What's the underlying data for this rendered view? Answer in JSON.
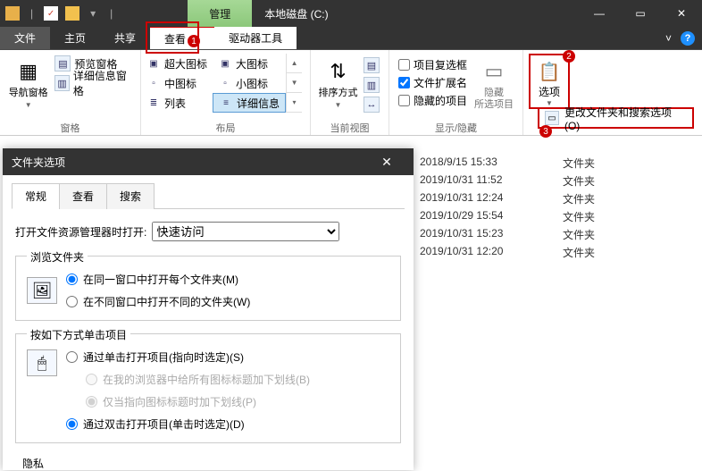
{
  "titlebar": {
    "contextual_tab": "管理",
    "window_title": "本地磁盘 (C:)"
  },
  "ribbon_tabs": {
    "file": "文件",
    "home": "主页",
    "share": "共享",
    "view": "查看",
    "drive_tools": "驱动器工具"
  },
  "annotations": {
    "one": "1",
    "two": "2",
    "three": "3"
  },
  "panes_group": {
    "nav_pane": "导航窗格",
    "preview_pane": "预览窗格",
    "details_pane": "详细信息窗格",
    "label": "窗格"
  },
  "layout_group": {
    "xl_icon": "超大图标",
    "l_icon": "大图标",
    "m_icon": "中图标",
    "s_icon": "小图标",
    "list": "列表",
    "details": "详细信息",
    "label": "布局"
  },
  "view_group": {
    "sort": "排序方式",
    "label": "当前视图"
  },
  "showhide_group": {
    "item_checkboxes": "项目复选框",
    "file_ext": "文件扩展名",
    "hidden_items": "隐藏的项目",
    "hide_selected": "隐藏\n所选项目",
    "label": "显示/隐藏"
  },
  "options_group": {
    "options": "选项",
    "change_folder_search": "更改文件夹和搜索选项(O)"
  },
  "files": [
    {
      "date": "2018/9/15 15:33",
      "type": "文件夹"
    },
    {
      "date": "2019/10/31 11:52",
      "type": "文件夹"
    },
    {
      "date": "2019/10/31 12:24",
      "type": "文件夹"
    },
    {
      "date": "2019/10/29 15:54",
      "type": "文件夹"
    },
    {
      "date": "2019/10/31 15:23",
      "type": "文件夹"
    },
    {
      "date": "2019/10/31 12:20",
      "type": "文件夹"
    }
  ],
  "dialog": {
    "title": "文件夹选项",
    "tabs": {
      "general": "常规",
      "view": "查看",
      "search": "搜索"
    },
    "open_label": "打开文件资源管理器时打开:",
    "open_value": "快速访问",
    "browse_legend": "浏览文件夹",
    "browse_opt1": "在同一窗口中打开每个文件夹(M)",
    "browse_opt2": "在不同窗口中打开不同的文件夹(W)",
    "click_legend": "按如下方式单击项目",
    "click_opt1": "通过单击打开项目(指向时选定)(S)",
    "click_sub1": "在我的浏览器中给所有图标标题加下划线(B)",
    "click_sub2": "仅当指向图标标题时加下划线(P)",
    "click_opt2": "通过双击打开项目(单击时选定)(D)",
    "privacy_legend": "隐私"
  }
}
